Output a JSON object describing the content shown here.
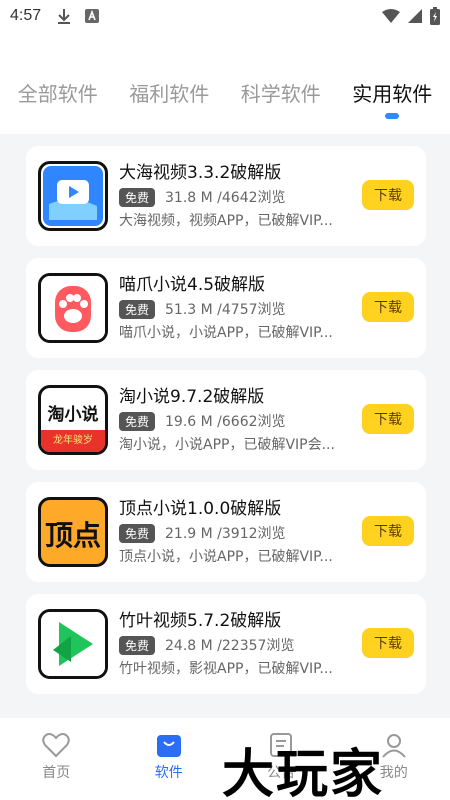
{
  "status_bar": {
    "time": "4:57"
  },
  "tabs": [
    {
      "label": "全部软件",
      "active": false
    },
    {
      "label": "福利软件",
      "active": false
    },
    {
      "label": "科学软件",
      "active": false
    },
    {
      "label": "实用软件",
      "active": true
    }
  ],
  "apps": [
    {
      "title": "大海视频3.3.2破解版",
      "badge": "免费",
      "stats": "31.8 M /4642浏览",
      "desc": "大海视频，视频APP，已破解VIP...",
      "button": "下载",
      "icon": "play-video-icon"
    },
    {
      "title": "喵爪小说4.5破解版",
      "badge": "免费",
      "stats": "51.3 M /4757浏览",
      "desc": "喵爪小说，小说APP，已破解VIP...",
      "button": "下载",
      "icon": "cat-paw-icon"
    },
    {
      "title": "淘小说9.7.2破解版",
      "badge": "免费",
      "stats": "19.6 M /6662浏览",
      "desc": "淘小说，小说APP，已破解VIP会...",
      "button": "下载",
      "icon": "tao-novel-icon",
      "icon_text": "淘小说",
      "icon_sub": "龙年骏岁"
    },
    {
      "title": "顶点小说1.0.0破解版",
      "badge": "免费",
      "stats": "21.9 M /3912浏览",
      "desc": "顶点小说，小说APP，已破解VIP...",
      "button": "下载",
      "icon": "dingdian-icon",
      "icon_text": "顶点"
    },
    {
      "title": "竹叶视频5.7.2破解版",
      "badge": "免费",
      "stats": "24.8 M /22357浏览",
      "desc": "竹叶视频，影视APP，已破解VIP...",
      "button": "下载",
      "icon": "bamboo-play-icon"
    }
  ],
  "bottom_nav": [
    {
      "label": "首页",
      "icon": "heart-icon",
      "active": false
    },
    {
      "label": "软件",
      "icon": "bag-icon",
      "active": true
    },
    {
      "label": "公告",
      "icon": "notice-icon",
      "active": false
    },
    {
      "label": "我的",
      "icon": "user-icon",
      "active": false
    }
  ],
  "watermark": "大玩家",
  "colors": {
    "accent": "#2b6df5",
    "button": "#ffd21f",
    "badge": "#555555"
  }
}
